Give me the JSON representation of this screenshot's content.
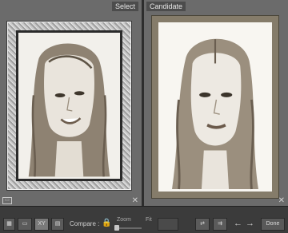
{
  "left_pane": {
    "label": "Select",
    "label_icon": "select-pane"
  },
  "right_pane": {
    "label": "Candidate"
  },
  "toolbar": {
    "compare_label": "Compare :",
    "zoom_label": "Zoom",
    "fit_label": "Fit",
    "done_label": "Done",
    "zoom_level": 0
  },
  "icons": {
    "grid": "grid-view-icon",
    "loupe": "loupe-view-icon",
    "compare": "compare-view-icon",
    "survey": "survey-view-icon",
    "lock": "lock-icon",
    "swap": "swap-icon",
    "make_select": "make-select-icon",
    "prev": "previous-arrow-icon",
    "next": "next-arrow-icon",
    "close": "close-icon"
  }
}
